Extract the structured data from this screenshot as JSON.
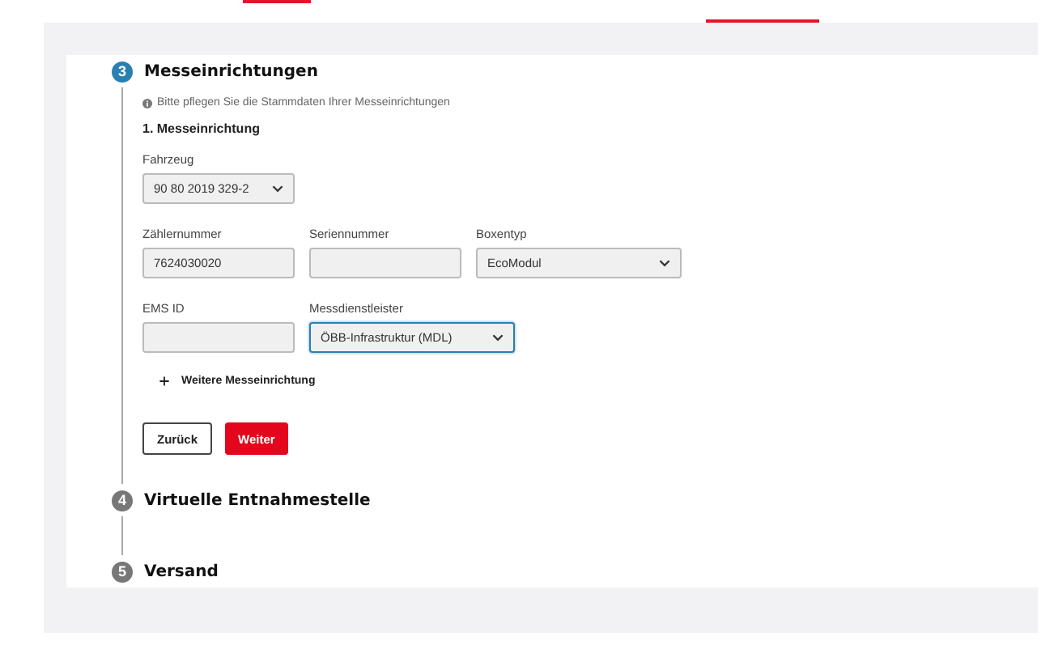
{
  "steps": [
    {
      "number": "3",
      "title": "Messeinrichtungen",
      "active": true,
      "info": "Bitte pflegen Sie die Stammdaten Ihrer Messeinrichtungen",
      "device_title": "1. Messeinrichtung",
      "field_rows": [
        [
          {
            "kind": "select",
            "label": "Fahrzeug",
            "value": "90 80 2019 329-2",
            "focused": false
          }
        ],
        [
          {
            "kind": "input",
            "label": "Zählernummer",
            "value": "7624030020",
            "focused": false
          },
          {
            "kind": "input",
            "label": "Seriennummer",
            "focused": false
          },
          {
            "kind": "select",
            "label": "Boxentyp",
            "value": "EcoModul",
            "focused": false
          }
        ],
        [
          {
            "kind": "input",
            "label": "EMS ID",
            "focused": false
          },
          {
            "kind": "select",
            "label": "Messdienstleister",
            "value": "ÖBB-Infrastruktur (MDL)",
            "focused": true
          }
        ]
      ],
      "add_label": "Weitere Messeinrichtung",
      "buttons": [
        {
          "label": "Zurück",
          "kind": "secondary"
        },
        {
          "label": "Weiter",
          "kind": "primary"
        }
      ]
    },
    {
      "number": "4",
      "title": "Virtuelle Entnahmestelle",
      "active": false
    },
    {
      "number": "5",
      "title": "Versand",
      "active": false
    }
  ]
}
